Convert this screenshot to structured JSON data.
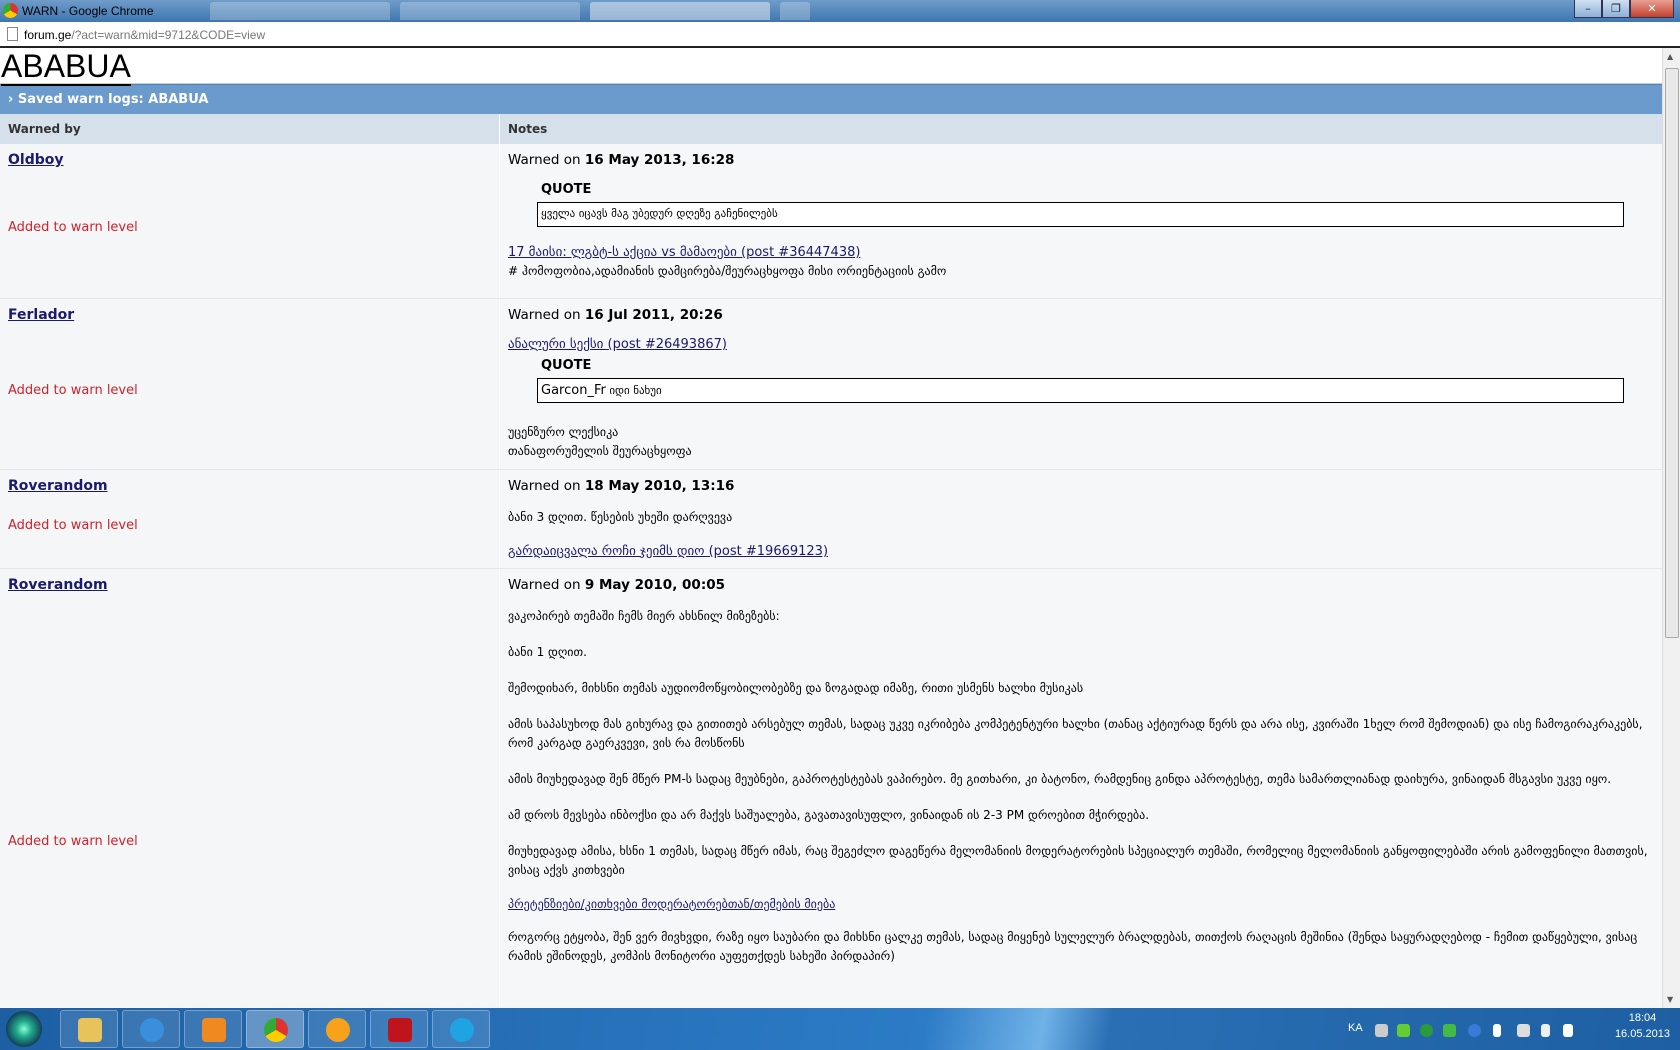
{
  "window": {
    "title": "WARN - Google Chrome",
    "controls": [
      "minimize",
      "restore",
      "close"
    ]
  },
  "address": {
    "host": "forum.ge",
    "path": "/?act=warn&mid=9712&CODE=view"
  },
  "page": {
    "title": "ABABUA",
    "bar": "Saved warn logs: ABABUA",
    "columns": [
      "Warned by",
      "Notes"
    ],
    "warned_prefix": "Warned on",
    "added_label": "Added to warn level",
    "quote_label": "QUOTE",
    "entries": [
      {
        "user": "Oldboy",
        "date": "16 May 2013, 16:28",
        "quote": "ყველა იცავს მაგ უბედურ დღეზე გაჩენილებს",
        "link": "17 მაისი: ლგბტ-ს აქცია vs მამაოები (post #36447438)",
        "note": "# ჰომოფობია,ადამიანის დამცირება/შეურაცხყოფა მისი ორიენტაციის გამო"
      },
      {
        "user": "Ferlador",
        "date": "16 Jul 2011, 20:26",
        "link": "ანალური სექსი (post #26493867)",
        "quote_user": "Garcon_Fr",
        "quote": "იდი ნახუი",
        "note1": "უცენზურო ლექსიკა",
        "note2": "თანაფორუმელის შეურაცხყოფა"
      },
      {
        "user": "Roverandom",
        "date": "18 May 2010, 13:16",
        "note": "ბანი 3 დღით. წესების უხეში დარღვევა",
        "link": "გარდაიცვალა როჩი ჯეიმს დიო (post #19669123)"
      },
      {
        "user": "Roverandom",
        "date": "9 May 2010, 00:05",
        "p1": "ვაკოპირებ თემაში ჩემს მიერ ახსნილ მიზეზებს:",
        "p2": "ბანი 1 დღით.",
        "p3": "შემოდიხარ, მიხსნი თემას აუდიომოწყობილობებზე და ზოგადად იმაზე, რითი უსმენს ხალხი მუსიკას",
        "p4": "ამის საპასუხოდ მას გიხურავ და გითითებ არსებულ თემას, სადაც უკვე იკრიბება კომპეტენტური ხალხი (თანაც აქტიურად წერს და არა ისე, კვირაში 1ხელ რომ შემოდიან) და ისე ჩამოგირაკრაკებს, რომ კარგად გაერკვევი, ვის რა მოსწონს",
        "p5": "ამის მიუხედავად შენ მწერ PM-ს სადაც მეუბნები, გაპროტესტებას ვაპირებო. მე გითხარი, კი ბატონო, რამდენიც გინდა აპროტესტე, თემა სამართლიანად დაიხურა, ვინაიდან მსგავსი უკვე იყო.",
        "p6": "ამ დროს მევსება ინბოქსი და არ მაქვს საშუალება, გავათავისუფლო, ვინაიდან ის 2-3 PM დროებით მჭირდება.",
        "p7": "მიუხედავად ამისა, ხსნი 1 თემას, სადაც მწერ იმას, რაც შეგეძლო დაგეწერა მელომანიის მოდერატორების სპეციალურ თემაში, რომელიც მელომანიის განყოფილებაში არის გამოფენილი მათთვის, ვისაც აქვს კითხვები",
        "link": "პრეტენზიები/კითხვები მოდერატორებთან/თემების მიება",
        "p8": "როგორც ეტყობა, შენ ვერ მივხვდი, რაზე იყო საუბარი და მიხსნი ცალკე თემას, სადაც მიყენებ სულელურ ბრალდებას, თითქოს რაღაცის მეშინია (შენდა საყურადღებოდ - ჩემით დაწყებული, ვისაც რამის ეშინოდეს, კომპის მონიტორი აუფეთქდეს სახეში პირდაპირ)"
      }
    ]
  },
  "taskbar": {
    "lang": "KA",
    "time": "18:04",
    "date": "16.05.2013"
  }
}
